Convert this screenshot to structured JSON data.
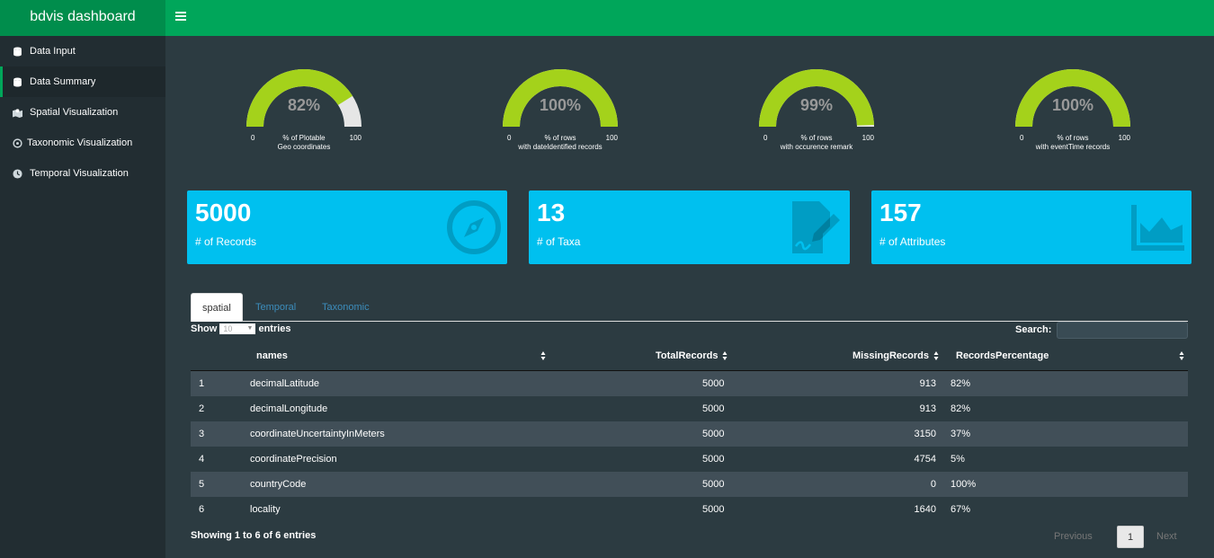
{
  "header": {
    "brand": "bdvis dashboard"
  },
  "sidebar": {
    "items": [
      {
        "label": "Data Input",
        "icon": "database-icon"
      },
      {
        "label": "Data Summary",
        "icon": "database-icon"
      },
      {
        "label": "Spatial Visualization",
        "icon": "map-icon"
      },
      {
        "label": "Taxonomic Visualization",
        "icon": "tree-icon"
      },
      {
        "label": "Temporal Visualization",
        "icon": "clock-icon"
      }
    ],
    "active_index": 1
  },
  "gauges": [
    {
      "value": "82%",
      "fraction": 0.82,
      "min": "0",
      "max": "100",
      "label_line1": "% of Plotable",
      "label_line2": "Geo coordinates"
    },
    {
      "value": "100%",
      "fraction": 1.0,
      "min": "0",
      "max": "100",
      "label_line1": "% of rows",
      "label_line2": "with dateIdentified records"
    },
    {
      "value": "99%",
      "fraction": 0.99,
      "min": "0",
      "max": "100",
      "label_line1": "% of rows",
      "label_line2": "with occurence remark"
    },
    {
      "value": "100%",
      "fraction": 1.0,
      "min": "0",
      "max": "100",
      "label_line1": "% of rows",
      "label_line2": "with eventTime records"
    }
  ],
  "value_boxes": [
    {
      "number": "5000",
      "label": "# of Records",
      "icon": "compass-icon"
    },
    {
      "number": "13",
      "label": "# of Taxa",
      "icon": "file-signature-icon"
    },
    {
      "number": "157",
      "label": "# of Attributes",
      "icon": "area-chart-icon"
    }
  ],
  "tabs": [
    {
      "label": "spatial",
      "active": true
    },
    {
      "label": "Temporal",
      "active": false
    },
    {
      "label": "Taxonomic",
      "active": false
    }
  ],
  "table_controls": {
    "show_label": "Show",
    "length_value": "10",
    "entries_label": "entries",
    "search_label": "Search:"
  },
  "table": {
    "columns": [
      "",
      "names",
      "TotalRecords",
      "MissingRecords",
      "RecordsPercentage"
    ],
    "rows": [
      [
        "1",
        "decimalLatitude",
        "5000",
        "913",
        "82%"
      ],
      [
        "2",
        "decimalLongitude",
        "5000",
        "913",
        "82%"
      ],
      [
        "3",
        "coordinateUncertaintyInMeters",
        "5000",
        "3150",
        "37%"
      ],
      [
        "4",
        "coordinatePrecision",
        "5000",
        "4754",
        "5%"
      ],
      [
        "5",
        "countryCode",
        "5000",
        "0",
        "100%"
      ],
      [
        "6",
        "locality",
        "5000",
        "1640",
        "67%"
      ]
    ],
    "info": "Showing 1 to 6 of 6 entries"
  },
  "pagination": {
    "previous": "Previous",
    "current": "1",
    "next": "Next"
  },
  "colors": {
    "header_green": "#00a65a",
    "gauge_green": "#a4d21b",
    "gauge_empty": "#e6e6e6",
    "box_aqua": "#00c0ef"
  }
}
